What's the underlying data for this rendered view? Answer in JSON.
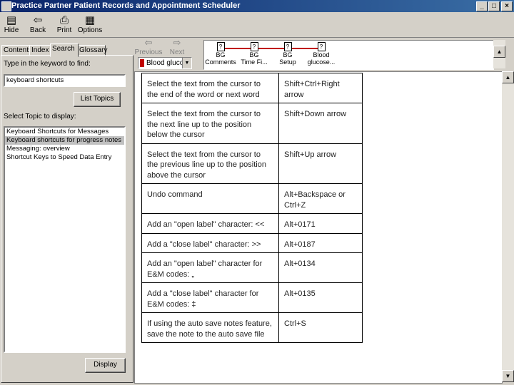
{
  "window": {
    "title": "Practice Partner Patient Records and Appointment Scheduler",
    "controls": [
      "_",
      "□",
      "×"
    ]
  },
  "toolbar": [
    {
      "name": "hide",
      "label": "Hide",
      "icon": "hide-icon",
      "glyph": "▤"
    },
    {
      "name": "back",
      "label": "Back",
      "icon": "back-arrow-icon",
      "glyph": "⇦"
    },
    {
      "name": "print",
      "label": "Print",
      "icon": "printer-icon",
      "glyph": "⎙"
    },
    {
      "name": "options",
      "label": "Options",
      "icon": "options-icon",
      "glyph": "▦"
    }
  ],
  "tabs": [
    {
      "label": "Contents"
    },
    {
      "label": "Index"
    },
    {
      "label": "Search"
    },
    {
      "label": "Glossary"
    }
  ],
  "search": {
    "prompt": "Type in the keyword to find:",
    "value": "keyboard shortcuts",
    "list_topics_label": "List Topics",
    "select_label": "Select Topic to display:",
    "results": [
      "Keyboard Shortcuts for Messages",
      "Keyboard shortcuts for progress notes",
      "Messaging: overview",
      "Shortcut Keys to Speed Data Entry"
    ],
    "selected_index": 1,
    "display_label": "Display"
  },
  "nav": {
    "previous_label": "Previous",
    "next_label": "Next",
    "dropdown_value": "Blood glucose",
    "topics": [
      {
        "line1": "BG",
        "line2": "Comments"
      },
      {
        "line1": "BG",
        "line2": "Time Fi..."
      },
      {
        "line1": "BG",
        "line2": "Setup"
      },
      {
        "line1": "Blood",
        "line2": "glucose..."
      }
    ],
    "accent_color": "#c00000"
  },
  "shortcuts": [
    {
      "action": "Select the text from the cursor to the end of the word or next word",
      "keys": "Shift+Ctrl+Right arrow"
    },
    {
      "action": "Select the text from the cursor to the next line up to the position below the cursor",
      "keys": "Shift+Down arrow"
    },
    {
      "action": "Select the text from the cursor to the previous line up to the position above the cursor",
      "keys": "Shift+Up arrow"
    },
    {
      "action": "Undo command",
      "keys": "Alt+Backspace or Ctrl+Z"
    },
    {
      "action": "Add an \"open label\" character: <<",
      "keys": "Alt+0171"
    },
    {
      "action": "Add a \"close label\" character: >>",
      "keys": "Alt+0187"
    },
    {
      "action": "Add an \"open label\" character for E&M codes: „",
      "keys": "Alt+0134"
    },
    {
      "action": "Add a \"close label\" character for E&M codes: ‡",
      "keys": "Alt+0135"
    },
    {
      "action": "If using the auto save notes feature, save the note to the auto save file",
      "keys": "Ctrl+S"
    }
  ]
}
